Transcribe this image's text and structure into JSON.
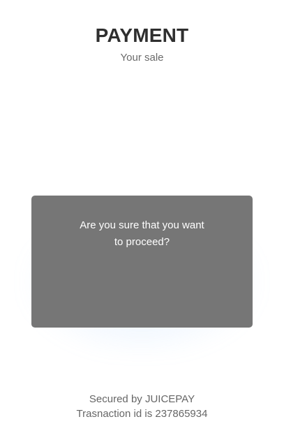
{
  "header": {
    "title": "PAYMENT",
    "subtitle": "Your sale"
  },
  "dialog": {
    "message": "Are you sure that you want to proceed?"
  },
  "footer": {
    "secured_by": "Secured by JUICEPAY",
    "transaction": "Trasnaction id is 237865934"
  },
  "colors": {
    "dialog_background": "#767676",
    "title_text": "#2f2f2f",
    "secondary_text": "#666666"
  }
}
